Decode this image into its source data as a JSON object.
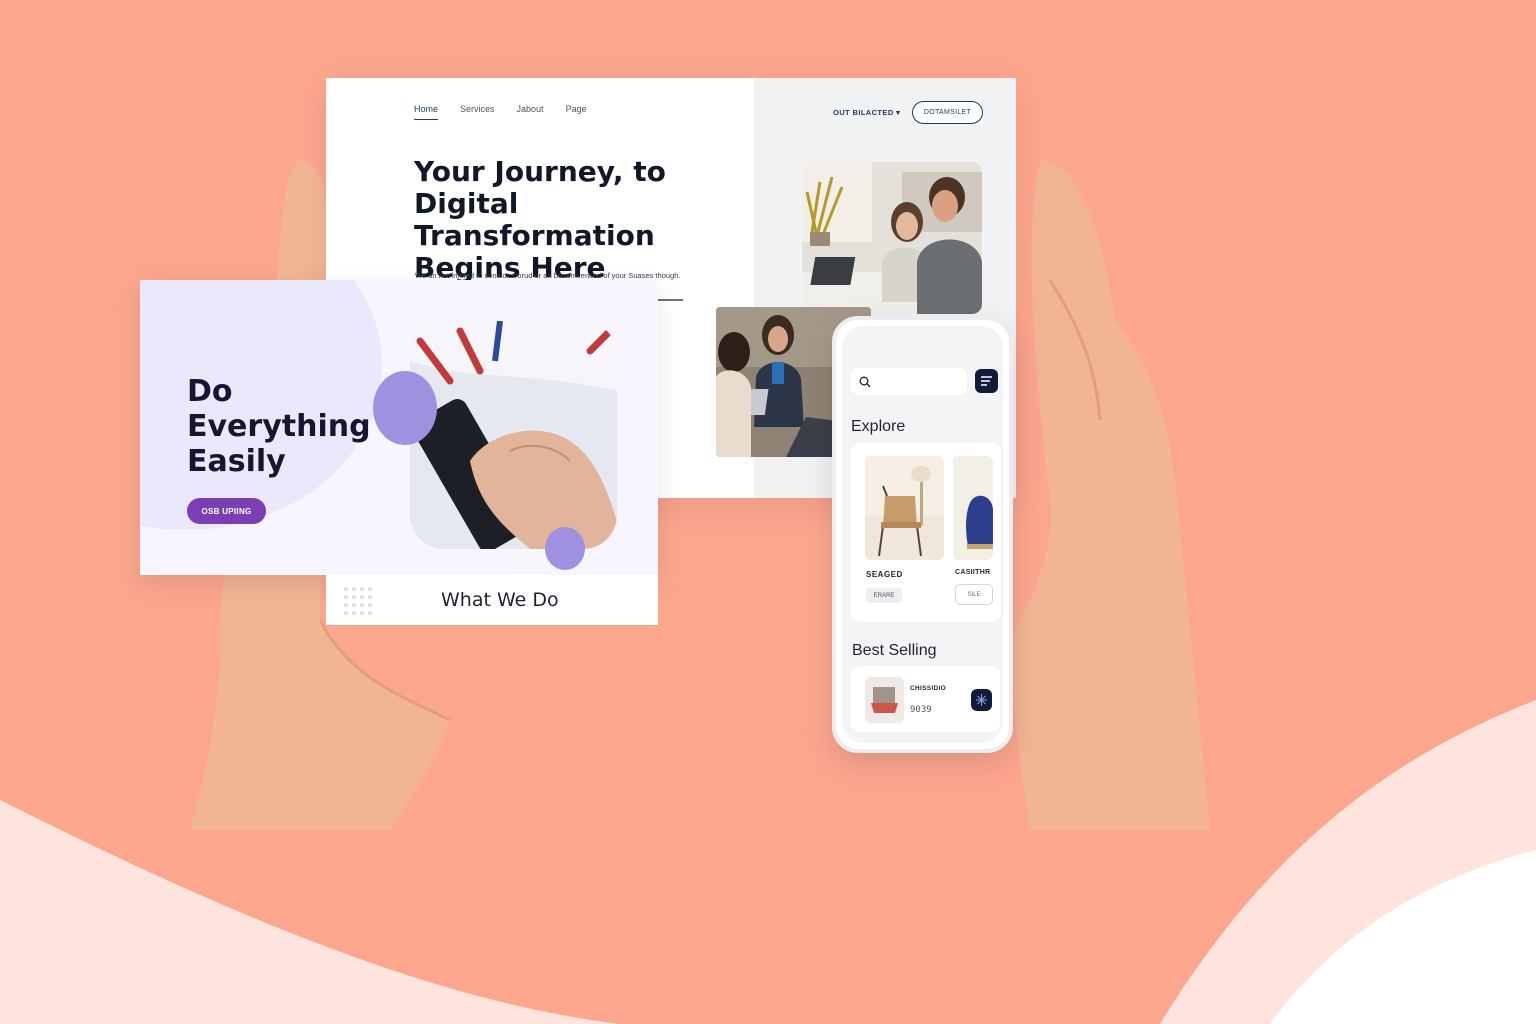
{
  "colors": {
    "background": "#FCA68E",
    "wave": "#FFE4DE",
    "accent_navy": "#1E3A5F",
    "accent_purple": "#7B3FB3",
    "circle_purple": "#9E92E0",
    "phone_dark_button": "#131A3A"
  },
  "website": {
    "nav": {
      "links": [
        "Home",
        "Services",
        "Jabout",
        "Page"
      ],
      "active": "Home",
      "dropdown_label": "OUT BILACTED",
      "cta_label": "DOTAMSILET"
    },
    "hero": {
      "title_line1": "Your Journey, to",
      "title_line2": "Digital Transformation",
      "title_line3": "Begins Here",
      "subtitle": "We an nutrimuted to senalor. Vorud or an be remvenced of your Suases though."
    }
  },
  "promo_card": {
    "title_line1": "Do",
    "title_line2": "Everything",
    "title_line3": "Easily",
    "button_label": "OSB UPIING"
  },
  "section": {
    "what_we_do": "What We Do"
  },
  "mobile_app": {
    "search_icon": "search-icon",
    "menu_icon": "menu-icon",
    "explore_heading": "Explore",
    "products": [
      {
        "name": "SEAGED",
        "tag": "ERARE"
      },
      {
        "name": "CASIITHR",
        "tag": "SILE"
      }
    ],
    "best_selling_heading": "Best Selling",
    "best_item": {
      "name": "CHISSIDIO",
      "price": "9039"
    }
  }
}
